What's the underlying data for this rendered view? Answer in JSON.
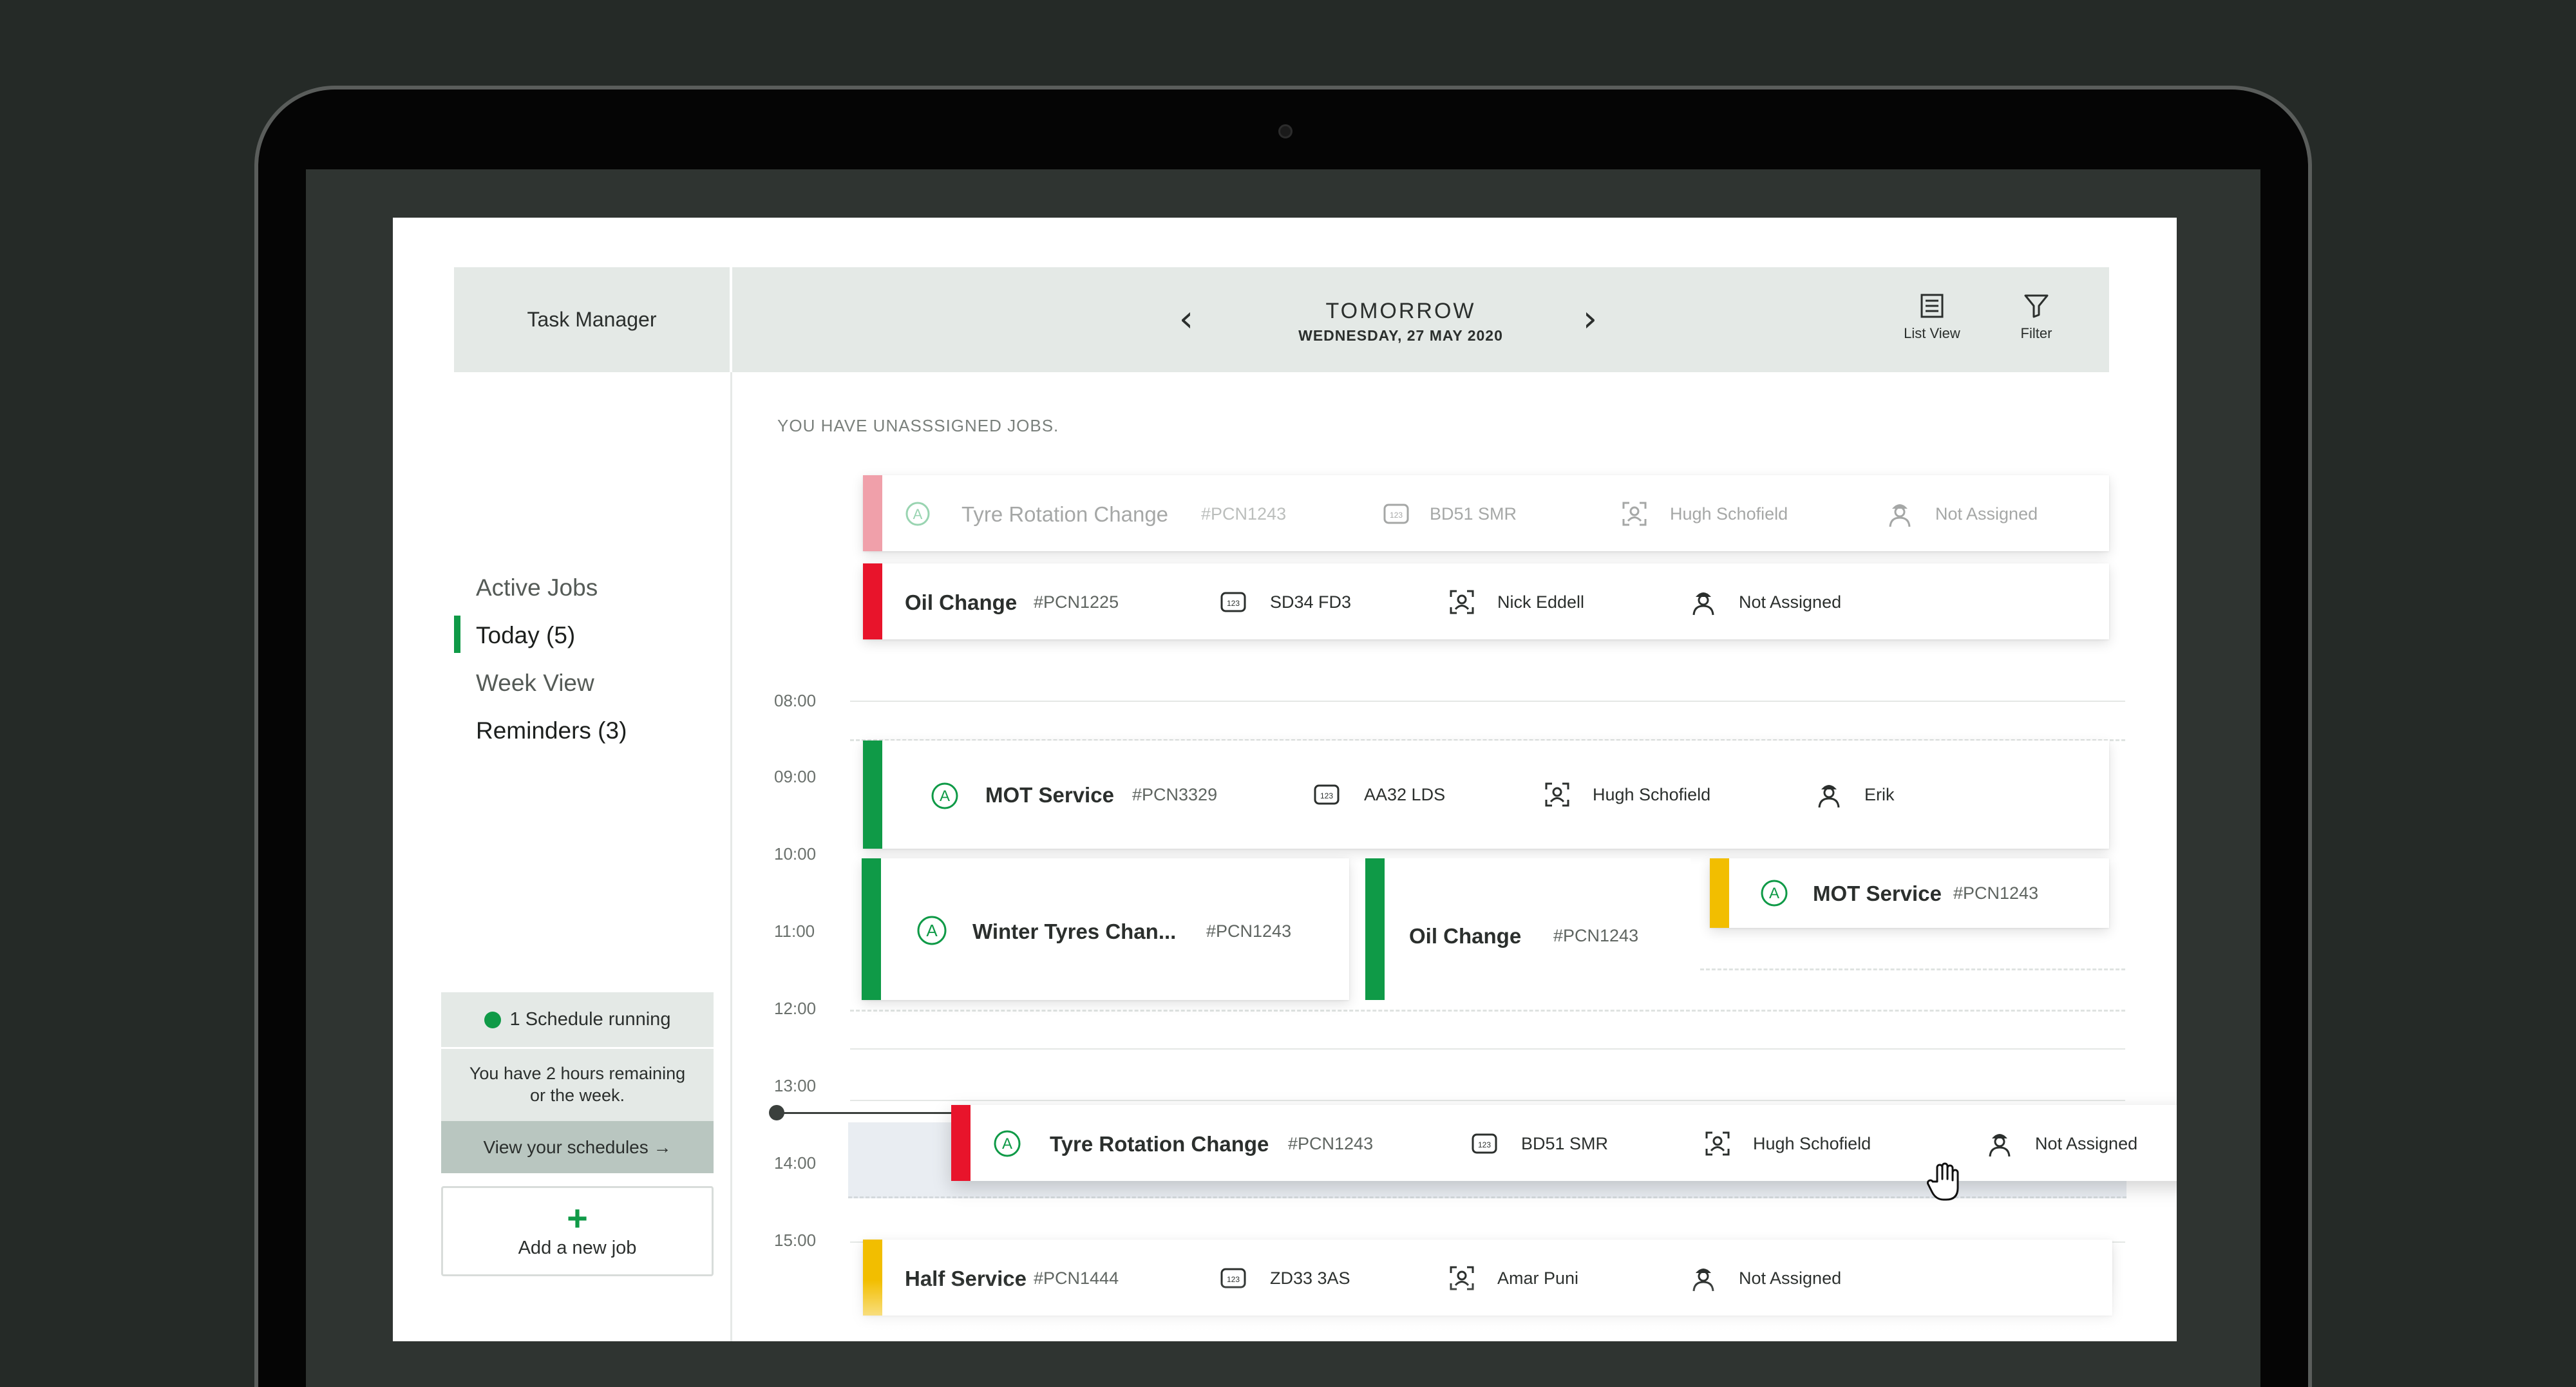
{
  "header": {
    "app_title": "Task Manager",
    "date_main": "TOMORROW",
    "date_sub": "WEDNESDAY, 27 MAY 2020",
    "tools": {
      "list_view": "List View",
      "filter": "Filter"
    }
  },
  "sidebar": {
    "items": [
      {
        "label": "Active Jobs"
      },
      {
        "label": "Today (5)"
      },
      {
        "label": "Week View"
      },
      {
        "label": "Reminders (3)"
      }
    ],
    "schedule": {
      "status": "1 Schedule running",
      "message": "You have 2 hours remaining or the week.",
      "link": "View your schedules →"
    },
    "add_job": {
      "plus": "+",
      "label": "Add a new job"
    }
  },
  "main": {
    "notice": "YOU HAVE UNASSSIGNED JOBS.",
    "unassigned": [
      {
        "title": "Tyre Rotation Change",
        "ref": "#PCN1243",
        "plate": "BD51 SMR",
        "customer": "Hugh Schofield",
        "assignee": "Not Assigned"
      },
      {
        "title": "Oil Change",
        "ref": "#PCN1225",
        "plate": "SD34 FD3",
        "customer": "Nick Eddell",
        "assignee": "Not Assigned"
      }
    ],
    "times": [
      "08:00",
      "09:00",
      "10:00",
      "11:00",
      "12:00",
      "13:00",
      "14:00",
      "15:00"
    ],
    "scheduled": [
      {
        "title": "MOT Service",
        "ref": "#PCN3329",
        "plate": "AA32 LDS",
        "customer": "Hugh Schofield",
        "assignee": "Erik"
      },
      {
        "title": "Winter Tyres Chan...",
        "ref": "#PCN1243"
      },
      {
        "title": "Oil Change",
        "ref": "#PCN1243"
      },
      {
        "title": "MOT Service",
        "ref": "#PCN1243"
      },
      {
        "title": "Half Service",
        "ref": "#PCN1444",
        "plate": "ZD33 3AS",
        "customer": "Amar Puni",
        "assignee": "Not Assigned"
      }
    ],
    "dragging": {
      "title": "Tyre Rotation Change",
      "ref": "#PCN1243",
      "plate": "BD51 SMR",
      "customer": "Hugh Schofield",
      "assignee": "Not Assigned"
    }
  },
  "colors": {
    "green": "#0f9a47",
    "red": "#e8142b",
    "yellow": "#f2be00",
    "header_bg": "#e4e9e6"
  }
}
